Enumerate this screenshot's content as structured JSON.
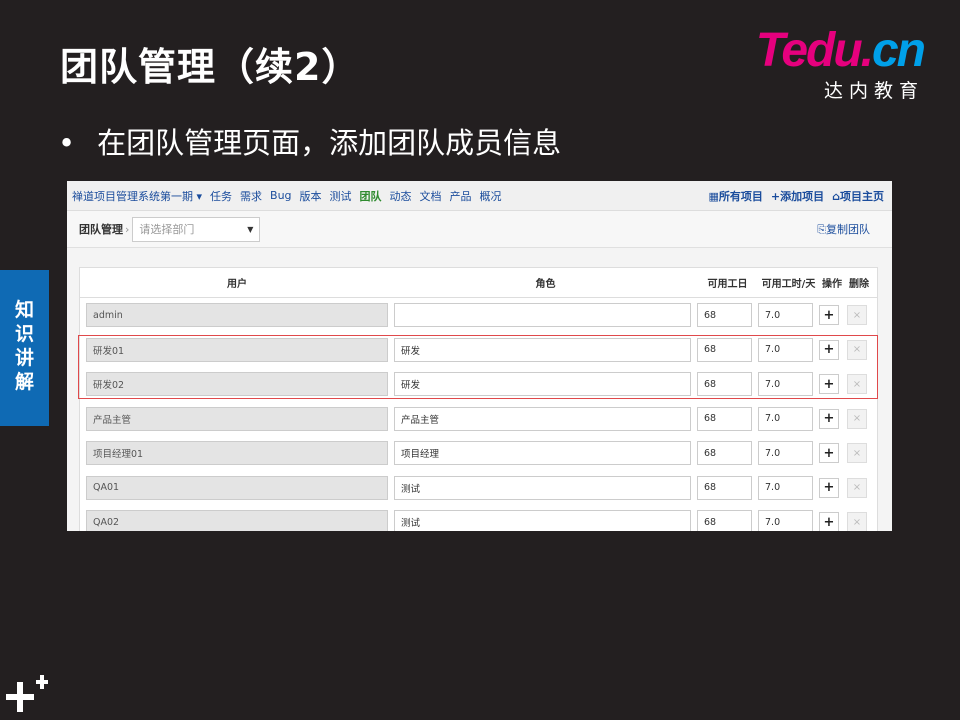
{
  "slide": {
    "title": "团队管理（续2）",
    "bullet": "在团队管理页面，添加团队成员信息",
    "side_tab": [
      "知",
      "识",
      "讲",
      "解"
    ],
    "logo": {
      "t": "T",
      "rest": "edu.",
      "cn": "cn",
      "sub": "达内教育"
    }
  },
  "app": {
    "nav": {
      "items": [
        "禅道项目管理系统第一期 ▾",
        "任务",
        "需求",
        "Bug",
        "版本",
        "测试",
        "团队",
        "动态",
        "文档",
        "产品",
        "概况"
      ],
      "active": "团队",
      "right": [
        {
          "icon": "grid-icon",
          "glyph": "▦",
          "label": "所有项目"
        },
        {
          "icon": "plus-icon",
          "glyph": "+",
          "label": "添加项目"
        },
        {
          "icon": "home-icon",
          "glyph": "⌂",
          "label": "项目主页"
        }
      ]
    },
    "subbar": {
      "crumb": "团队管理",
      "sep": "›",
      "dept_placeholder": "请选择部门",
      "copy_team": "复制团队",
      "copy_icon": "⎘"
    },
    "table": {
      "headers": {
        "user": "用户",
        "role": "角色",
        "days": "可用工日",
        "hours": "可用工时/天",
        "op": "操作",
        "del": "删除"
      },
      "rows": [
        {
          "user": "admin",
          "role": "",
          "days": "68",
          "hours": "7.0"
        },
        {
          "user": "研发01",
          "role": "研发",
          "days": "68",
          "hours": "7.0"
        },
        {
          "user": "研发02",
          "role": "研发",
          "days": "68",
          "hours": "7.0"
        },
        {
          "user": "产品主管",
          "role": "产品主管",
          "days": "68",
          "hours": "7.0"
        },
        {
          "user": "项目经理01",
          "role": "项目经理",
          "days": "68",
          "hours": "7.0"
        },
        {
          "user": "QA01",
          "role": "测试",
          "days": "68",
          "hours": "7.0"
        },
        {
          "user": "QA02",
          "role": "测试",
          "days": "68",
          "hours": "7.0"
        }
      ],
      "add_glyph": "+",
      "del_glyph": "×"
    }
  },
  "colors": {
    "background": "#231f20",
    "side_tab": "#0f6ab4",
    "logo_pink": "#e6007e",
    "logo_blue": "#00a0e9",
    "highlight": "#e0494b"
  }
}
